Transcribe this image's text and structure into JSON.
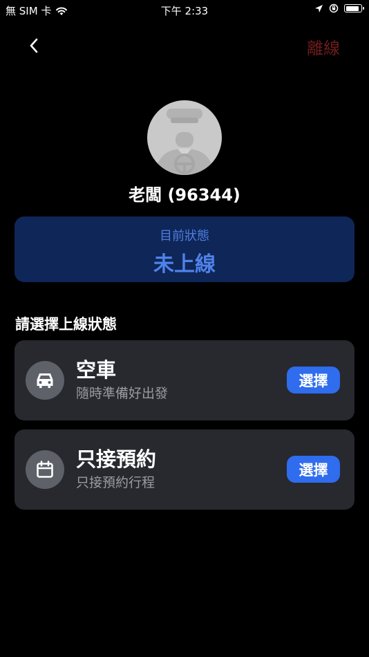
{
  "status_bar": {
    "carrier": "無 SIM 卡",
    "time": "下午 2:33",
    "battery_level": 0.9
  },
  "header": {
    "back_icon": "chevron-left-icon",
    "offline_label": "離線"
  },
  "driver": {
    "name": "老闆 (96344)"
  },
  "current_status": {
    "label": "目前狀態",
    "value": "未上線"
  },
  "section_title": "請選擇上線狀態",
  "options": [
    {
      "icon": "car-icon",
      "title": "空車",
      "description": "隨時準備好出發",
      "button_label": "選擇"
    },
    {
      "icon": "calendar-icon",
      "title": "只接預約",
      "description": "只接預約行程",
      "button_label": "選擇"
    }
  ],
  "colors": {
    "accent": "#2f6cee",
    "status_card": "#0f2658",
    "offline_text": "#6e1c1c",
    "card_bg": "#27292f"
  }
}
